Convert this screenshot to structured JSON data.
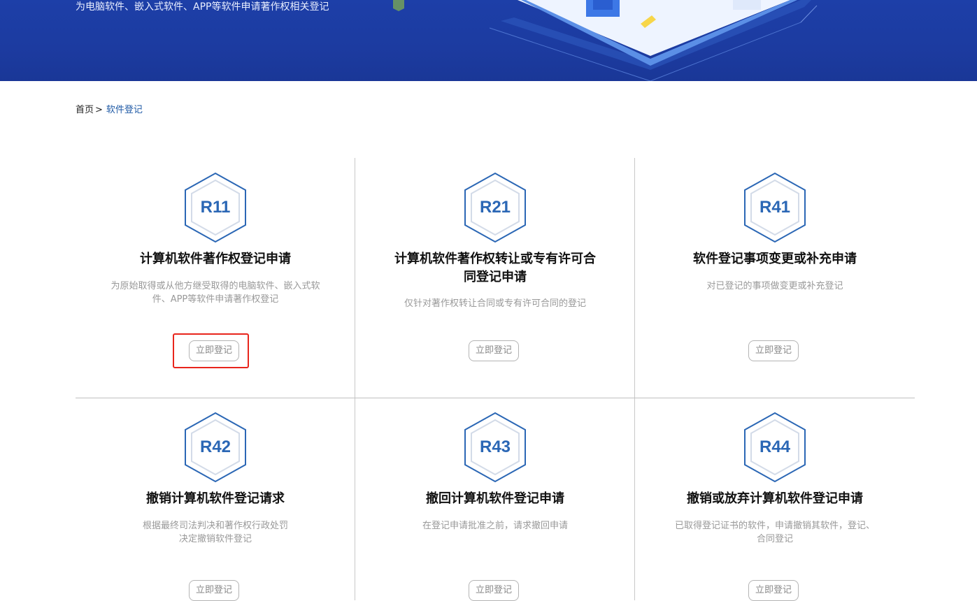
{
  "banner": {
    "subtitle": "为电脑软件、嵌入式软件、APP等软件申请著作权相关登记"
  },
  "breadcrumb": {
    "home": "首页",
    "separator": ">",
    "current": "软件登记"
  },
  "colors": {
    "banner": "#1c3ba0",
    "accent": "#2b67b5",
    "highlight": "#e8251c"
  },
  "cards": [
    {
      "code": "R11",
      "title": "计算机软件著作权登记申请",
      "desc": "为原始取得或从他方继受取得的电脑软件、嵌入式软件、APP等软件申请著作权登记",
      "button": "立即登记"
    },
    {
      "code": "R21",
      "title": "计算机软件著作权转让或专有许可合同登记申请",
      "desc": "仅针对著作权转让合同或专有许可合同的登记",
      "button": "立即登记"
    },
    {
      "code": "R41",
      "title": "软件登记事项变更或补充申请",
      "desc": "对已登记的事项做变更或补充登记",
      "button": "立即登记"
    },
    {
      "code": "R42",
      "title": "撤销计算机软件登记请求",
      "desc": "根据最终司法判决和著作权行政处罚决定撤销软件登记",
      "button": "立即登记"
    },
    {
      "code": "R43",
      "title": "撤回计算机软件登记申请",
      "desc": "在登记申请批准之前，请求撤回申请",
      "button": "立即登记"
    },
    {
      "code": "R44",
      "title": "撤销或放弃计算机软件登记申请",
      "desc": "已取得登记证书的软件，申请撤销其软件，登记、合同登记",
      "button": "立即登记"
    }
  ]
}
